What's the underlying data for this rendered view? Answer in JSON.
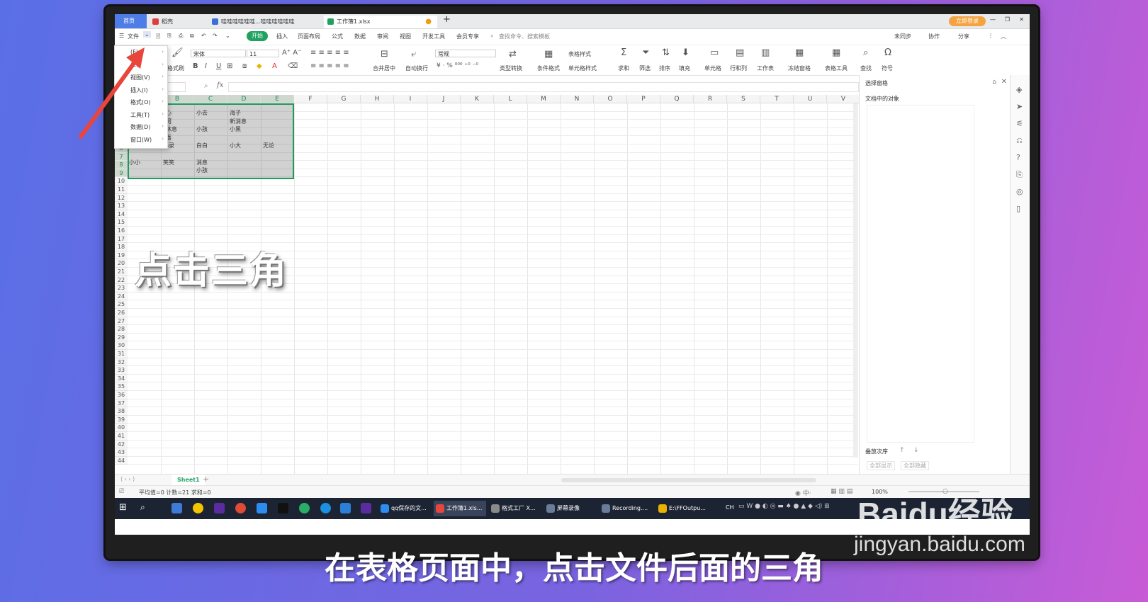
{
  "tabs": {
    "home": "首页",
    "doc": "稻壳",
    "word": "哇哇哇哇哇哇...哇哇哇哇哇哇",
    "sheet": "工作簿1.xlsx",
    "add": "+"
  },
  "titlebar": {
    "login": "立即登录"
  },
  "menu": {
    "file": "文件",
    "start": "开始",
    "items": [
      "插入",
      "页面布局",
      "公式",
      "数据",
      "审阅",
      "视图",
      "开发工具",
      "会员专享"
    ],
    "search": "查找命令、搜索模板",
    "right": [
      "未同步",
      "协作",
      "分享"
    ]
  },
  "ribbon": {
    "format_brush": "格式刷",
    "font": "宋体",
    "font_size": "11",
    "number_format": "常规",
    "merge": "合并居中",
    "wrap": "自动换行",
    "convert": "类型转换",
    "cond_format": "条件格式",
    "table_style": "表格样式",
    "cell_style": "单元格样式",
    "sum": "求和",
    "filter": "筛选",
    "sort": "排序",
    "fill": "填充",
    "cell": "单元格",
    "rowcol": "行和列",
    "worksheet": "工作表",
    "freeze": "冻结窗格",
    "table_tools": "表格工具",
    "find": "查找",
    "symbol": "符号"
  },
  "file_dropdown": [
    "(F)",
    "(E)",
    "视图(V)",
    "插入(I)",
    "格式(O)",
    "工具(T)",
    "数据(D)",
    "窗口(W)"
  ],
  "formula": {
    "fx": "fx"
  },
  "columns": [
    "B",
    "C",
    "D",
    "E",
    "F",
    "G",
    "H",
    "I",
    "J",
    "K",
    "L",
    "M",
    "N",
    "O",
    "P",
    "Q",
    "R",
    "S",
    "T",
    "U",
    "V"
  ],
  "rows": [
    "6",
    "7",
    "8",
    "9",
    "10",
    "11",
    "12",
    "13",
    "14",
    "15",
    "16",
    "17",
    "18",
    "19",
    "20",
    "21",
    "22",
    "23",
    "24",
    "25",
    "26",
    "27",
    "28",
    "29",
    "30",
    "31",
    "32",
    "33",
    "34",
    "35",
    "36",
    "37",
    "38",
    "39",
    "40",
    "41",
    "42",
    "43",
    "44"
  ],
  "cells": {
    "b1": "心",
    "c1": "小去",
    "d1": "海子",
    "b2": "河",
    "d2": "新消息",
    "b3": "休息",
    "c3": "小孩",
    "d3": "小黑",
    "b4": "喜",
    "a6": "拜拜",
    "b6": "小录",
    "c6": "白白",
    "d6": "小大",
    "e6": "无论",
    "a8": "小小",
    "b8": "笑笑",
    "c8": "消息",
    "c9": "小孩"
  },
  "right_pane": {
    "title": "选择窗格",
    "subtitle": "文档中的对象",
    "order": "叠放次序",
    "show_all": "全部显示",
    "hide_all": "全部隐藏"
  },
  "sheet_tab": "Sheet1",
  "status": {
    "stats": "平均值=0  计数=21  求和=0",
    "zoom": "100%"
  },
  "taskbar": {
    "apps": [
      "qq保存的文...",
      "工作簿1.xls...",
      "格式工厂 X...",
      "屏幕录像",
      "Recording....",
      "E:\\FFOutpu..."
    ],
    "tray_ime": "CH"
  },
  "overlay": {
    "caption": "点击三角",
    "subtitle": "在表格页面中，点击文件后面的三角",
    "wm_logo": "Baidu经验",
    "wm_url": "jingyan.baidu.com"
  },
  "colors": {
    "accent": "#1fa261",
    "selection_border": "#1f9a5c",
    "arrow": "#e8453c"
  }
}
